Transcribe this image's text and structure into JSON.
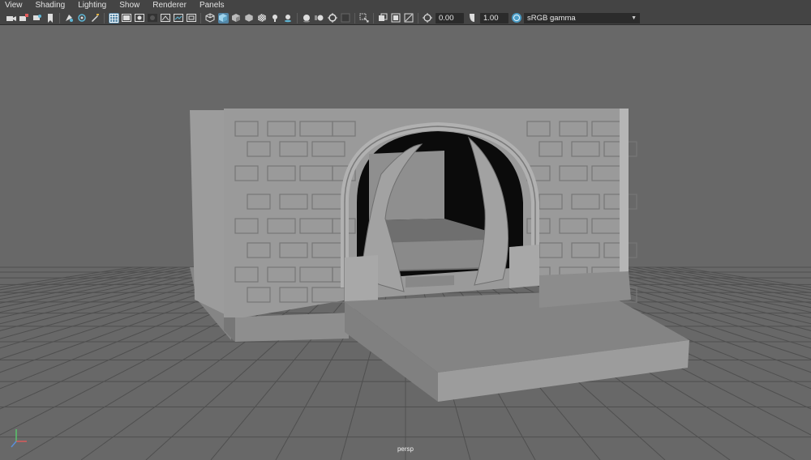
{
  "menu": [
    "View",
    "Shading",
    "Lighting",
    "Show",
    "Renderer",
    "Panels"
  ],
  "toolbar": {
    "exposure_value": "0.00",
    "gamma_value": "1.00",
    "color_space": "sRGB gamma",
    "icons": [
      "camera-select-icon",
      "camera-attributes-icon",
      "bookmark-icon",
      "image-plane-icon",
      "two-d-pan-zoom-icon",
      "grease-pencil-icon",
      "grid-icon",
      "film-gate-icon",
      "resolution-gate-icon",
      "gate-mask-icon",
      "field-chart-icon",
      "safe-action-icon",
      "safe-title-icon",
      "wireframe-icon",
      "smooth-shade-icon",
      "default-material-icon",
      "wireframe-on-shaded-icon",
      "textured-icon",
      "lighting-icon",
      "shadows-icon",
      "screen-space-ao-icon",
      "motion-blur-icon",
      "anti-aliasing-icon",
      "depth-of-field-icon",
      "isolate-select-icon",
      "xray-icon",
      "xray-joints-icon",
      "backface-cull-icon",
      "exposure-icon",
      "gamma-icon",
      "color-management-icon"
    ]
  },
  "viewport": {
    "camera": "persp"
  },
  "colors": {
    "bg": "#686868",
    "toolbar": "#444444",
    "active": "#5285a6"
  }
}
